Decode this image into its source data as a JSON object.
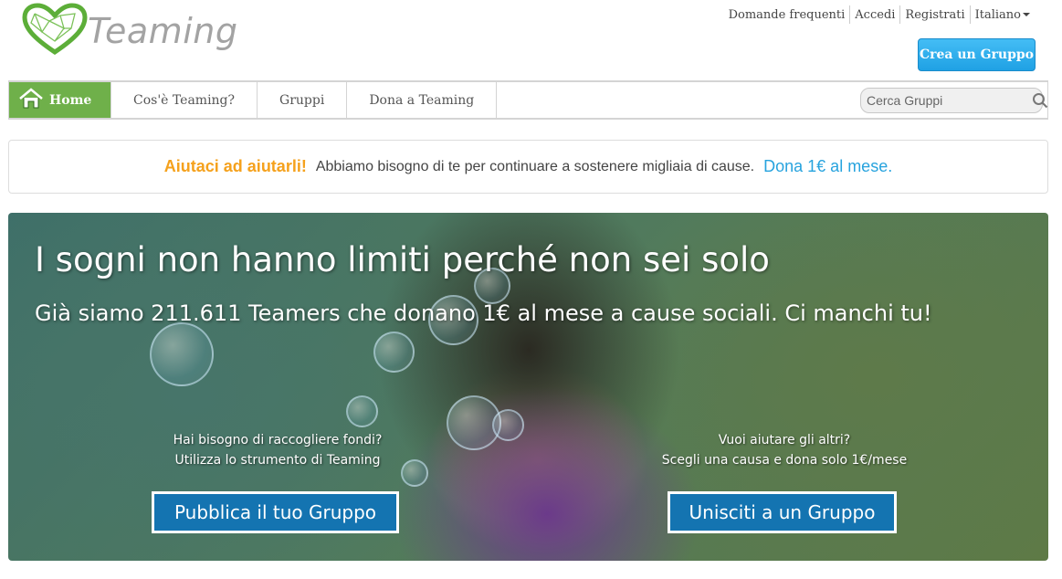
{
  "header": {
    "logo_text": "Teaming",
    "top_links": {
      "faq": "Domande frequenti",
      "login": "Accedi",
      "register": "Registrati",
      "language": "Italiano"
    },
    "create_group": "Crea un Gruppo"
  },
  "nav": {
    "home": "Home",
    "about": "Cos'è Teaming?",
    "groups": "Gruppi",
    "donate": "Dona a Teaming",
    "search_placeholder": "Cerca Gruppi"
  },
  "promo": {
    "highlight": "Aiutaci ad aiutarli!",
    "message": "Abbiamo bisogno di te per continuare a sostenere migliaia di cause.",
    "link": "Dona 1€ al mese."
  },
  "hero": {
    "title": "I sogni non hanno limiti perché non sei solo",
    "subtitle": "Già siamo 211.611 Teamers che donano 1€ al mese a cause sociali. Ci manchi tu!",
    "left": {
      "line1": "Hai bisogno di raccogliere fondi?",
      "line2": "Utilizza lo strumento di Teaming",
      "button": "Pubblica il tuo Gruppo"
    },
    "right": {
      "line1": "Vuoi aiutare gli altri?",
      "line2": "Scegli una causa e dona solo 1€/mese",
      "button": "Unisciti a un Gruppo"
    }
  },
  "colors": {
    "brand_green": "#6fb04a",
    "accent_blue": "#27a3de",
    "button_blue": "#1474b1",
    "promo_orange": "#f5a11c"
  },
  "icons": {
    "logo": "heart-network-logo-icon",
    "home": "house-icon",
    "search": "magnifier-icon",
    "language_caret": "caret-down-icon"
  }
}
